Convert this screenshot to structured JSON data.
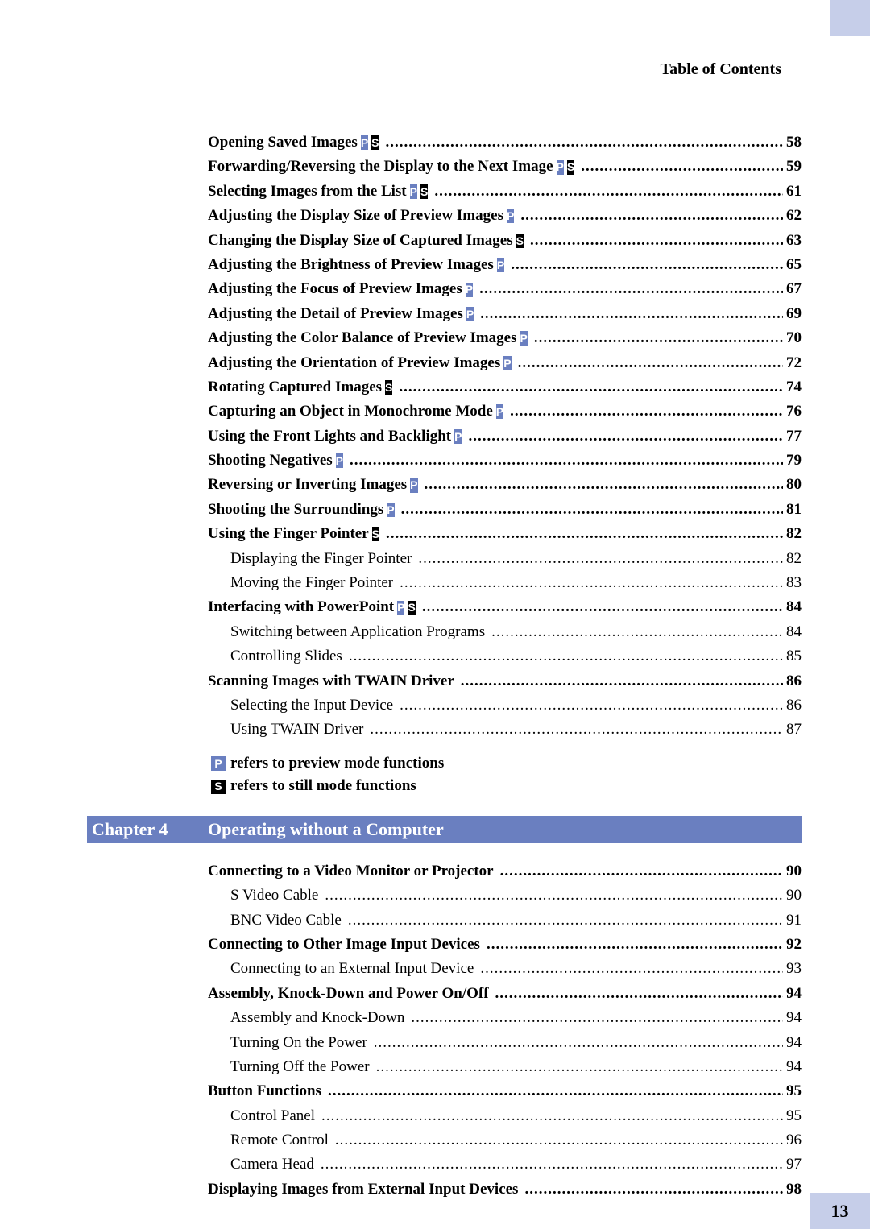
{
  "header": "Table of Contents",
  "pageNumber": "13",
  "entries1": [
    {
      "text": "Opening Saved Images",
      "badges": [
        "P",
        "S"
      ],
      "page": "58",
      "bold": true,
      "sub": false
    },
    {
      "text": "Forwarding/Reversing the Display to the Next Image",
      "badges": [
        "P",
        "S"
      ],
      "page": "59",
      "bold": true,
      "sub": false
    },
    {
      "text": "Selecting Images from the List",
      "badges": [
        "P",
        "S"
      ],
      "page": "61",
      "bold": true,
      "sub": false
    },
    {
      "text": "Adjusting the Display Size of Preview Images",
      "badges": [
        "P"
      ],
      "page": "62",
      "bold": true,
      "sub": false
    },
    {
      "text": "Changing the Display Size of Captured Images",
      "badges": [
        "S"
      ],
      "page": "63",
      "bold": true,
      "sub": false
    },
    {
      "text": "Adjusting the Brightness of Preview Images",
      "badges": [
        "P"
      ],
      "page": "65",
      "bold": true,
      "sub": false
    },
    {
      "text": "Adjusting the Focus of Preview Images",
      "badges": [
        "P"
      ],
      "page": "67",
      "bold": true,
      "sub": false
    },
    {
      "text": "Adjusting the Detail of Preview Images",
      "badges": [
        "P"
      ],
      "page": "69",
      "bold": true,
      "sub": false
    },
    {
      "text": "Adjusting the Color Balance of Preview Images",
      "badges": [
        "P"
      ],
      "page": "70",
      "bold": true,
      "sub": false
    },
    {
      "text": "Adjusting the Orientation of Preview Images",
      "badges": [
        "P"
      ],
      "page": "72",
      "bold": true,
      "sub": false
    },
    {
      "text": "Rotating Captured Images",
      "badges": [
        "S"
      ],
      "page": "74",
      "bold": true,
      "sub": false
    },
    {
      "text": "Capturing an Object in Monochrome Mode",
      "badges": [
        "P"
      ],
      "page": "76",
      "bold": true,
      "sub": false
    },
    {
      "text": "Using the Front Lights and Backlight",
      "badges": [
        "P"
      ],
      "page": "77",
      "bold": true,
      "sub": false
    },
    {
      "text": "Shooting Negatives",
      "badges": [
        "P"
      ],
      "page": "79",
      "bold": true,
      "sub": false
    },
    {
      "text": "Reversing or Inverting Images",
      "badges": [
        "P"
      ],
      "page": "80",
      "bold": true,
      "sub": false
    },
    {
      "text": "Shooting the Surroundings",
      "badges": [
        "P"
      ],
      "page": "81",
      "bold": true,
      "sub": false
    },
    {
      "text": "Using the Finger Pointer",
      "badges": [
        "S"
      ],
      "page": "82",
      "bold": true,
      "sub": false
    },
    {
      "text": "Displaying the Finger Pointer",
      "badges": [],
      "page": "82",
      "bold": false,
      "sub": true
    },
    {
      "text": "Moving the Finger Pointer",
      "badges": [],
      "page": "83",
      "bold": false,
      "sub": true
    },
    {
      "text": "Interfacing with PowerPoint",
      "badges": [
        "P",
        "S"
      ],
      "page": "84",
      "bold": true,
      "sub": false
    },
    {
      "text": "Switching between Application Programs",
      "badges": [],
      "page": "84",
      "bold": false,
      "sub": true
    },
    {
      "text": "Controlling Slides",
      "badges": [],
      "page": "85",
      "bold": false,
      "sub": true
    },
    {
      "text": "Scanning Images with TWAIN Driver",
      "badges": [],
      "page": "86",
      "bold": true,
      "sub": false
    },
    {
      "text": "Selecting the Input Device",
      "badges": [],
      "page": "86",
      "bold": false,
      "sub": true
    },
    {
      "text": "Using TWAIN Driver",
      "badges": [],
      "page": "87",
      "bold": false,
      "sub": true
    }
  ],
  "legend": {
    "p": "refers to preview mode functions",
    "s": "refers to still mode functions"
  },
  "chapter": {
    "label": "Chapter 4",
    "title": "Operating without a Computer"
  },
  "entries2": [
    {
      "text": "Connecting to a Video Monitor or Projector",
      "badges": [],
      "page": "90",
      "bold": true,
      "sub": false
    },
    {
      "text": "S Video Cable",
      "badges": [],
      "page": "90",
      "bold": false,
      "sub": true
    },
    {
      "text": "BNC Video Cable",
      "badges": [],
      "page": "91",
      "bold": false,
      "sub": true
    },
    {
      "text": "Connecting to Other Image Input Devices",
      "badges": [],
      "page": "92",
      "bold": true,
      "sub": false
    },
    {
      "text": "Connecting to an External Input Device",
      "badges": [],
      "page": "93",
      "bold": false,
      "sub": true
    },
    {
      "text": "Assembly, Knock-Down and Power On/Off",
      "badges": [],
      "page": "94",
      "bold": true,
      "sub": false
    },
    {
      "text": "Assembly and Knock-Down",
      "badges": [],
      "page": "94",
      "bold": false,
      "sub": true
    },
    {
      "text": "Turning On the Power",
      "badges": [],
      "page": "94",
      "bold": false,
      "sub": true
    },
    {
      "text": "Turning Off the Power",
      "badges": [],
      "page": "94",
      "bold": false,
      "sub": true
    },
    {
      "text": "Button Functions",
      "badges": [],
      "page": "95",
      "bold": true,
      "sub": false
    },
    {
      "text": "Control Panel",
      "badges": [],
      "page": "95",
      "bold": false,
      "sub": true
    },
    {
      "text": "Remote Control",
      "badges": [],
      "page": "96",
      "bold": false,
      "sub": true
    },
    {
      "text": "Camera Head",
      "badges": [],
      "page": "97",
      "bold": false,
      "sub": true
    },
    {
      "text": "Displaying Images from External Input Devices",
      "badges": [],
      "page": "98",
      "bold": true,
      "sub": false
    }
  ]
}
